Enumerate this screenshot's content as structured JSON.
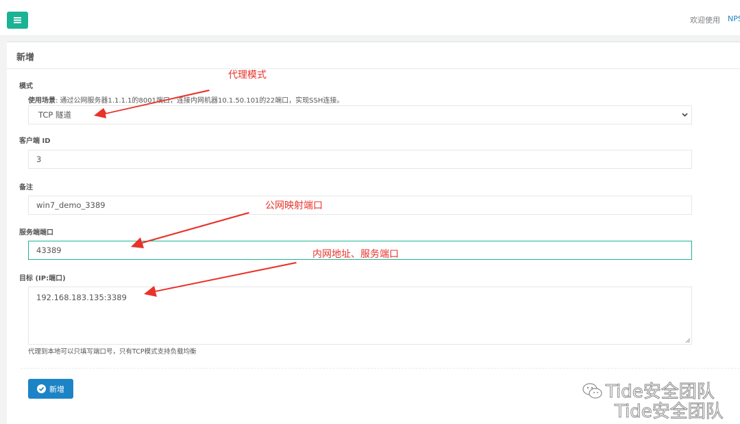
{
  "topbar": {
    "menu_icon": "hamburger-icon",
    "accent": "#1ab394",
    "welcome_text": "欢迎使用",
    "nps_link": "NPS"
  },
  "panel": {
    "title": "新增"
  },
  "form": {
    "mode_label": "模式",
    "mode_hint_bold": "使用场景",
    "mode_hint_text": ": 通过公网服务器1.1.1.1的8001端口，连接内网机器10.1.50.101的22端口，实现SSH连接。",
    "mode_value": "TCP 隧道",
    "client_id_label": "客户端 ID",
    "client_id_value": "3",
    "remark_label": "备注",
    "remark_value": "win7_demo_3389",
    "server_port_label": "服务端端口",
    "server_port_value": "43389",
    "target_label": "目标 (IP:端口)",
    "target_value": "192.168.183.135:3389",
    "target_help": "代理到本地可以只填写端口号，只有TCP模式支持负载均衡",
    "submit_label": "新增",
    "submit_color": "#1c84c6"
  },
  "annotations": {
    "color": "#e8322a",
    "proxy_mode": "代理模式",
    "public_port": "公网映射端口",
    "internal_addr": "内网地址、服务端口"
  },
  "watermark": {
    "line1": "Tide安全团队",
    "line2": "Tide安全团队"
  }
}
